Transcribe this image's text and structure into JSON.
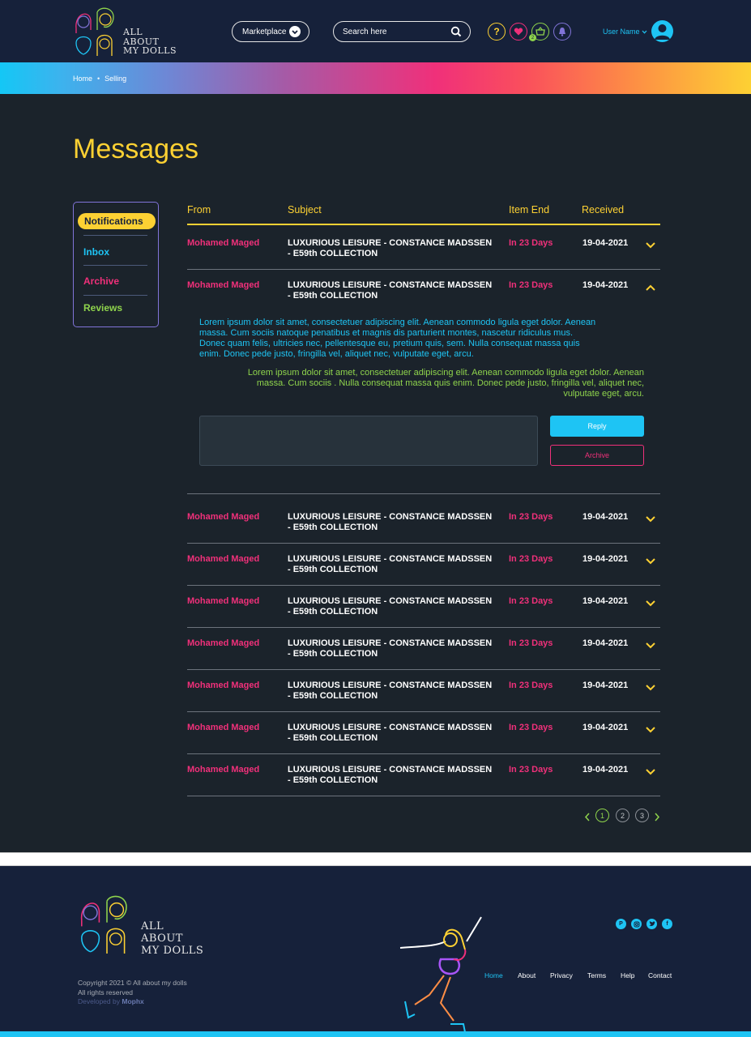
{
  "header": {
    "logo_lines": [
      "ALL",
      "ABOUT",
      "MY DOLLS"
    ],
    "marketplace_label": "Marketplace",
    "search_placeholder": "Search here",
    "icons": [
      "help-icon",
      "heart-icon",
      "basket-icon",
      "bell-icon"
    ],
    "cart_count": "2",
    "user_name": "User Name"
  },
  "breadcrumb": {
    "home": "Home",
    "separator": "•",
    "current": "Selling"
  },
  "page_title": "Messages",
  "sidebar": {
    "items": [
      {
        "label": "Notifications",
        "color": "#16213a",
        "active": true
      },
      {
        "label": "Inbox",
        "color": "#1ec4f4"
      },
      {
        "label": "Archive",
        "color": "#f0307a"
      },
      {
        "label": "Reviews",
        "color": "#8fd44c"
      }
    ]
  },
  "table": {
    "headers": {
      "from": "From",
      "subject": "Subject",
      "item_end": "Item End",
      "received": "Received"
    },
    "rows": [
      {
        "from": "Mohamed Maged",
        "subject": "LUXURIOUS LEISURE - CONSTANCE MADSSEN - E59th COLLECTION",
        "end": "In 23 Days",
        "date": "19-04-2021",
        "expanded": false
      },
      {
        "from": "Mohamed Maged",
        "subject": "LUXURIOUS LEISURE - CONSTANCE MADSSEN - E59th COLLECTION",
        "end": "In 23 Days",
        "date": "19-04-2021",
        "expanded": true
      },
      {
        "from": "Mohamed Maged",
        "subject": "LUXURIOUS LEISURE - CONSTANCE MADSSEN - E59th COLLECTION",
        "end": "In 23 Days",
        "date": "19-04-2021",
        "expanded": false
      },
      {
        "from": "Mohamed Maged",
        "subject": "LUXURIOUS LEISURE - CONSTANCE MADSSEN - E59th COLLECTION",
        "end": "In 23 Days",
        "date": "19-04-2021",
        "expanded": false
      },
      {
        "from": "Mohamed Maged",
        "subject": "LUXURIOUS LEISURE - CONSTANCE MADSSEN - E59th COLLECTION",
        "end": "In 23 Days",
        "date": "19-04-2021",
        "expanded": false
      },
      {
        "from": "Mohamed Maged",
        "subject": "LUXURIOUS LEISURE - CONSTANCE MADSSEN - E59th COLLECTION",
        "end": "In 23 Days",
        "date": "19-04-2021",
        "expanded": false
      },
      {
        "from": "Mohamed Maged",
        "subject": "LUXURIOUS LEISURE - CONSTANCE MADSSEN - E59th COLLECTION",
        "end": "In 23 Days",
        "date": "19-04-2021",
        "expanded": false
      },
      {
        "from": "Mohamed Maged",
        "subject": "LUXURIOUS LEISURE - CONSTANCE MADSSEN - E59th COLLECTION",
        "end": "In 23 Days",
        "date": "19-04-2021",
        "expanded": false
      },
      {
        "from": "Mohamed Maged",
        "subject": "LUXURIOUS LEISURE - CONSTANCE MADSSEN - E59th COLLECTION",
        "end": "In 23 Days",
        "date": "19-04-2021",
        "expanded": false
      }
    ]
  },
  "conversation": {
    "received_message": "Lorem ipsum dolor sit amet, consectetuer adipiscing elit. Aenean commodo ligula eget dolor. Aenean massa. Cum sociis natoque penatibus et magnis dis parturient montes, nascetur ridiculus mus. Donec quam felis, ultricies nec, pellentesque eu, pretium quis, sem. Nulla consequat massa quis enim. Donec pede justo, fringilla vel, aliquet nec, vulputate eget, arcu.",
    "sent_message": "Lorem ipsum dolor sit amet, consectetuer adipiscing elit. Aenean commodo ligula eget dolor. Aenean massa. Cum sociis . Nulla consequat massa quis enim. Donec pede justo, fringilla vel, aliquet nec, vulputate eget, arcu.",
    "reply_value": "",
    "reply_label": "Reply",
    "archive_label": "Archive"
  },
  "pagination": {
    "pages": [
      "1",
      "2",
      "3"
    ],
    "current": "1"
  },
  "footer": {
    "logo_lines": [
      "ALL",
      "ABOUT",
      "MY DOLLS"
    ],
    "copyright": "Copyright 2021 © All about my dolls",
    "rights": "All rights reserved",
    "developed_by": "Developed by",
    "developer": "Mophx",
    "social": [
      "pinterest-icon",
      "instagram-icon",
      "twitter-icon",
      "facebook-icon"
    ],
    "nav": [
      "Home",
      "About",
      "Privacy",
      "Terms",
      "Help",
      "Contact"
    ],
    "nav_active": "Home"
  },
  "colors": {
    "navy": "#16213a",
    "body_bg": "#1b232b",
    "yellow": "#fdd133",
    "pink": "#f0307a",
    "cyan": "#1ec4f4",
    "green": "#8fd44c",
    "purple": "#8174d8"
  }
}
